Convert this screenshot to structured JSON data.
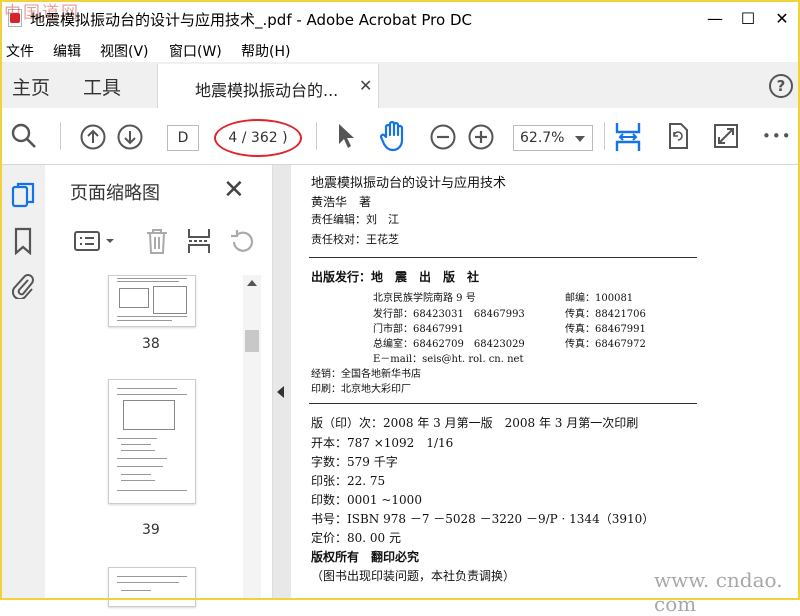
{
  "window": {
    "title": "地震模拟振动台的设计与应用技术_.pdf - Adobe Acrobat Pro DC",
    "watermark_top": "中国道网",
    "minimize": "—",
    "maximize": "☐",
    "close": "✕"
  },
  "menu": [
    "文件",
    "编辑",
    "视图(V)",
    "窗口(W)",
    "帮助(H)"
  ],
  "tabs": {
    "home": "主页",
    "tools": "工具",
    "document": "地震模拟振动台的...",
    "close": "✕",
    "help": "?"
  },
  "toolbar": {
    "page_current": "D",
    "page_count": "4 / 362 )",
    "zoom": "62.7%",
    "more": "•••"
  },
  "panel": {
    "title": "页面缩略图",
    "close": "✕",
    "thumbnails": [
      {
        "label": "38"
      },
      {
        "label": "39"
      }
    ]
  },
  "document": {
    "lines": {
      "book_title": "地震模拟振动台的设计与应用技术",
      "author": "黄浩华　著",
      "editor": "责任编辑：刘　江",
      "proofreader": "责任校对：王花芝",
      "publisher": "出版发行：地　震　出　版　社",
      "address": "北京民族学院南路 9 号",
      "postcode": "邮编：100081",
      "dept_sales": "发行部：68423031　68467993",
      "fax1": "传真：88421706",
      "dept_store": "门市部：68467991",
      "fax2": "传真：68467991",
      "dept_edit": "总编室：68462709　68423029",
      "fax3": "传真：68467972",
      "email": "E－mail：seis@ht. rol. cn. net",
      "distributor": "经销：全国各地新华书店",
      "printer": "印刷：北京地大彩印厂",
      "edition": "版（印）次：2008 年 3 月第一版　2008 年 3 月第一次印刷",
      "format": "开本：787 ×1092　1/16",
      "words": "字数：579 千字",
      "sheets": "印张：22. 75",
      "print_run": "印数：0001 ~1000",
      "isbn": "书号：ISBN 978 －7 －5028 －3220 －9/P · 1344（3910）",
      "price": "定价：80. 00 元",
      "rights": "版权所有　翻印必究",
      "notice": "（图书出现印装问题，本社负责调换）"
    }
  },
  "watermark_bottom": "www. cndao. com",
  "colors": {
    "accent_blue": "#1473e6",
    "highlight_red": "#e0242b",
    "frame_yellow": "#f0d23c"
  },
  "icons": [
    "search-icon",
    "arrow-up-icon",
    "arrow-down-icon",
    "cursor-icon",
    "hand-icon",
    "zoom-out-icon",
    "zoom-in-icon",
    "fit-page-icon",
    "rotate-icon",
    "full-screen-icon",
    "more-icon",
    "thumbnails-icon",
    "bookmark-icon",
    "attachment-icon",
    "options-icon",
    "delete-icon",
    "insert-page-icon",
    "undo-icon",
    "collapse-icon"
  ]
}
